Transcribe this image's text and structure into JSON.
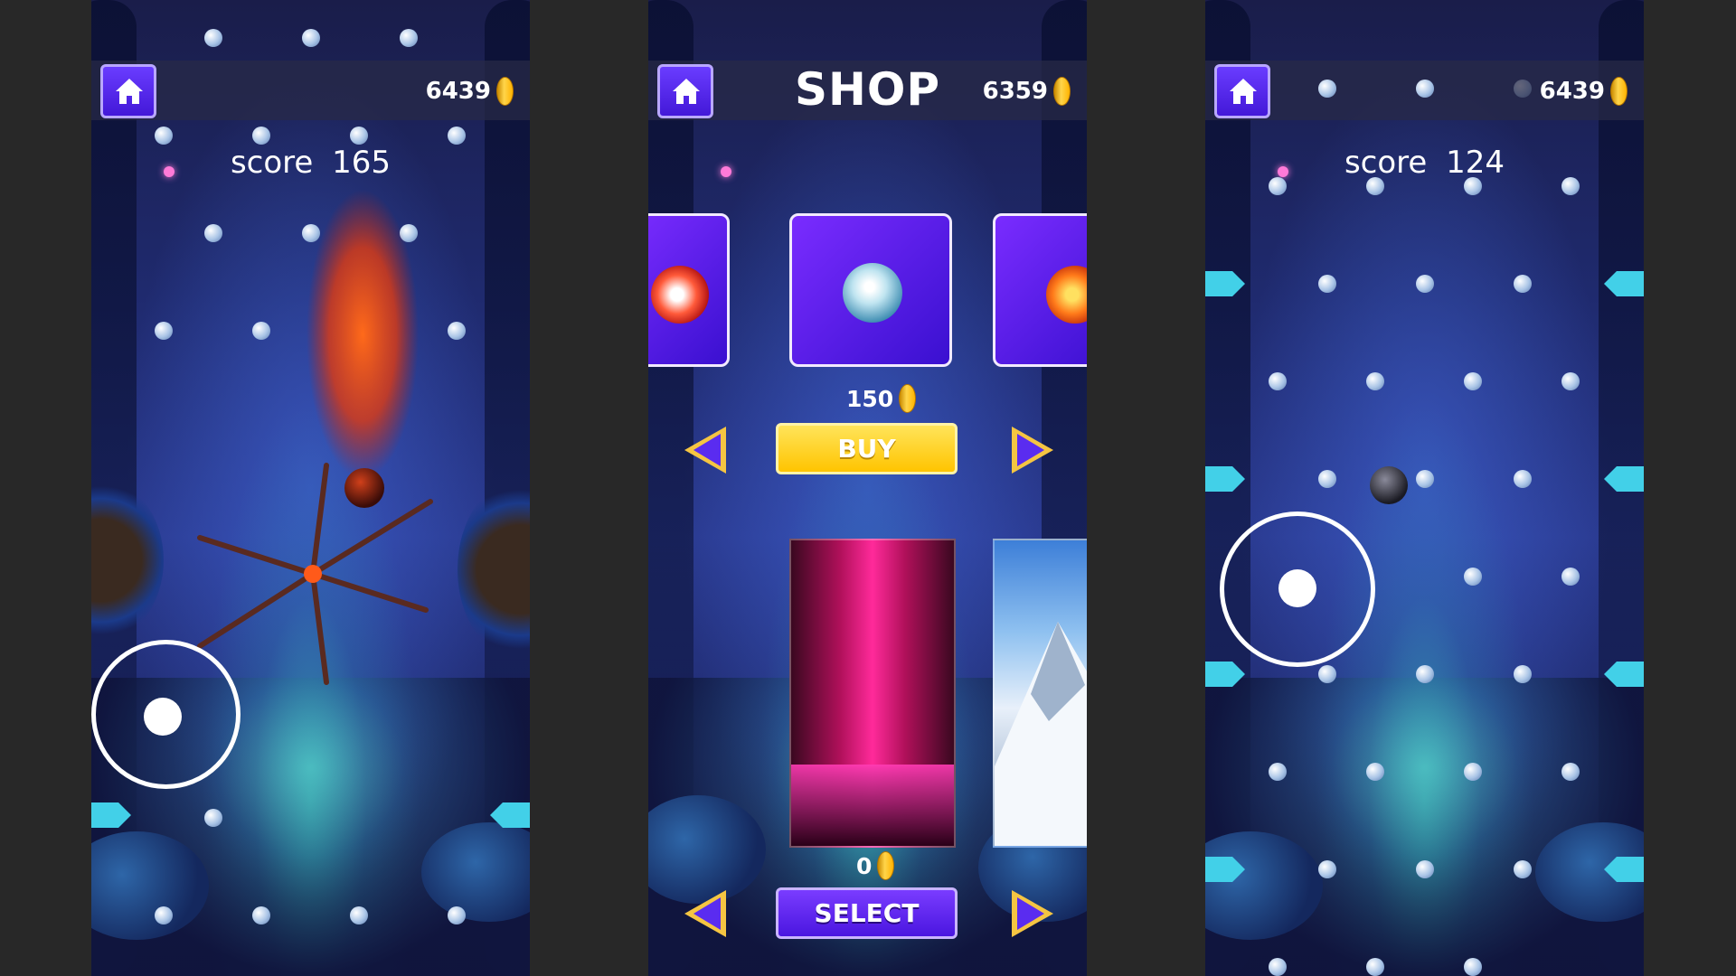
{
  "left_screen": {
    "coins": "6439",
    "score_label": "score",
    "score_value": "165"
  },
  "shop_screen": {
    "title": "SHOP",
    "coins": "6359",
    "ball_price": "150",
    "buy_label": "BUY",
    "background_price": "0",
    "select_label": "SELECT"
  },
  "right_screen": {
    "coins": "6439",
    "score_label": "score",
    "score_value": "124"
  },
  "colors": {
    "accent_purple": "#5a2cf0",
    "buy_yellow": "#ffd21f",
    "coin_gold": "#ffc21a",
    "background_bar": "#282828"
  },
  "icons": [
    "home-icon",
    "coin-icon",
    "arrow-left-icon",
    "arrow-right-icon"
  ]
}
